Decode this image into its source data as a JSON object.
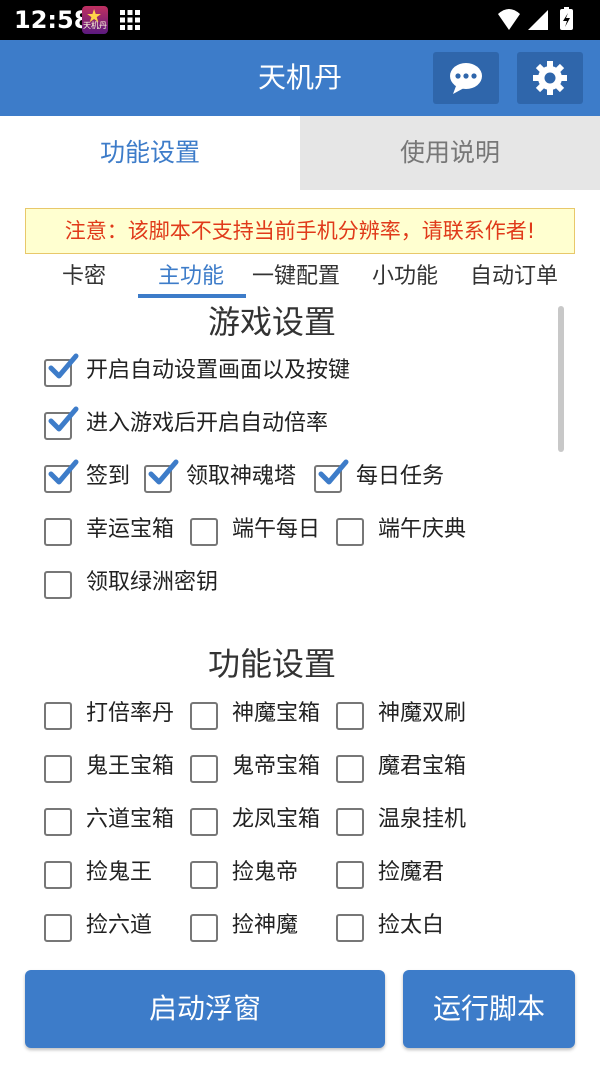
{
  "status": {
    "time": "12:58",
    "app_icon_text": "天机丹"
  },
  "header": {
    "title": "天机丹",
    "chat_icon": "chat-bubble-icon",
    "settings_icon": "gear-icon"
  },
  "tabs": [
    {
      "label": "功能设置",
      "active": true
    },
    {
      "label": "使用说明",
      "active": false
    }
  ],
  "notice": "注意：该脚本不支持当前手机分辨率，请联系作者!",
  "subtabs": [
    "卡密",
    "主功能",
    "一键配置",
    "小功能",
    "自动订单"
  ],
  "game_settings": {
    "title": "游戏设置",
    "options": [
      {
        "label": "开启自动设置画面以及按键",
        "checked": true
      },
      {
        "label": "进入游戏后开启自动倍率",
        "checked": true
      },
      {
        "label": "签到",
        "checked": true
      },
      {
        "label": "领取神魂塔",
        "checked": true
      },
      {
        "label": "每日任务",
        "checked": true
      },
      {
        "label": "幸运宝箱",
        "checked": false
      },
      {
        "label": "端午每日",
        "checked": false
      },
      {
        "label": "端午庆典",
        "checked": false
      },
      {
        "label": "领取绿洲密钥",
        "checked": false
      }
    ]
  },
  "function_settings": {
    "title": "功能设置",
    "options": [
      {
        "label": "打倍率丹",
        "checked": false
      },
      {
        "label": "神魔宝箱",
        "checked": false
      },
      {
        "label": "神魔双刷",
        "checked": false
      },
      {
        "label": "鬼王宝箱",
        "checked": false
      },
      {
        "label": "鬼帝宝箱",
        "checked": false
      },
      {
        "label": "魔君宝箱",
        "checked": false
      },
      {
        "label": "六道宝箱",
        "checked": false
      },
      {
        "label": "龙凤宝箱",
        "checked": false
      },
      {
        "label": "温泉挂机",
        "checked": false
      },
      {
        "label": "捡鬼王",
        "checked": false
      },
      {
        "label": "捡鬼帝",
        "checked": false
      },
      {
        "label": "捡魔君",
        "checked": false
      },
      {
        "label": "捡六道",
        "checked": false
      },
      {
        "label": "捡神魔",
        "checked": false
      },
      {
        "label": "捡太白",
        "checked": false
      }
    ]
  },
  "buttons": {
    "float_window": "启动浮窗",
    "run_script": "运行脚本"
  },
  "colors": {
    "primary": "#3d7cc9",
    "primary_dark": "#2f66ab",
    "notice_text": "#e03a1a",
    "notice_bg": "#ffffd0"
  }
}
